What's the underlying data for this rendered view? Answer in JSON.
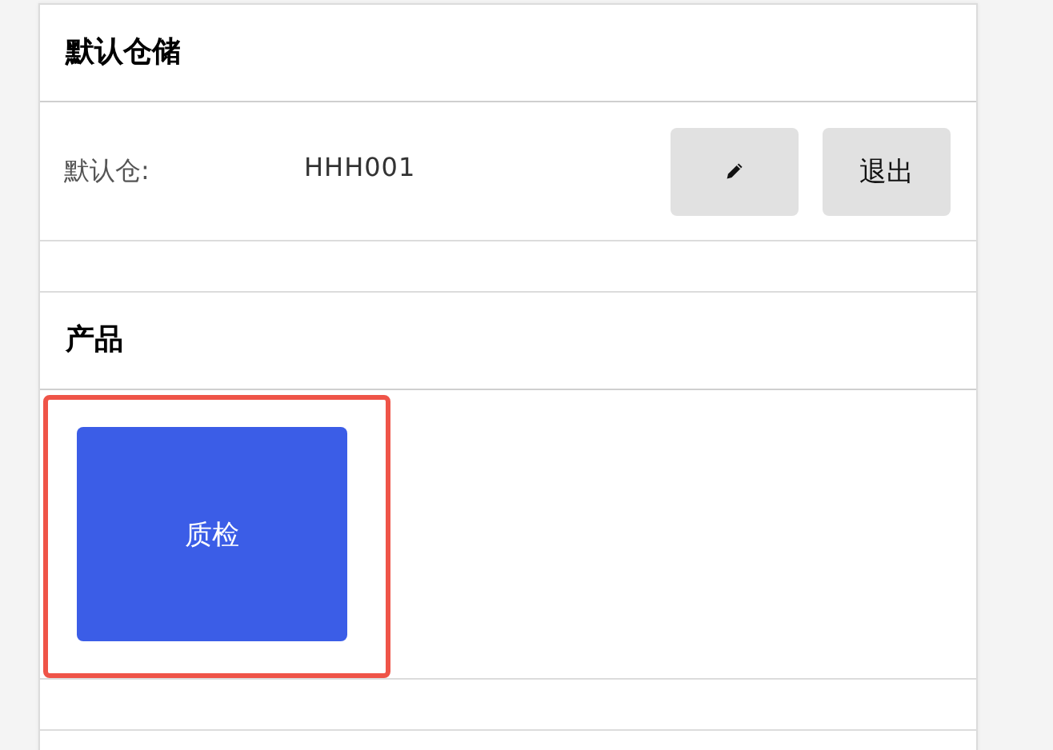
{
  "sections": [
    {
      "kind": "warehouse",
      "title": "默认仓储",
      "label": "默认仓:",
      "value": "HHH001",
      "buttons": [
        {
          "kind": "edit"
        },
        {
          "kind": "text",
          "label": "退出"
        }
      ]
    },
    {
      "kind": "products",
      "title": "产品",
      "items": [
        {
          "label": "质检",
          "highlighted": true
        }
      ]
    },
    {
      "kind": "blank"
    }
  ]
}
